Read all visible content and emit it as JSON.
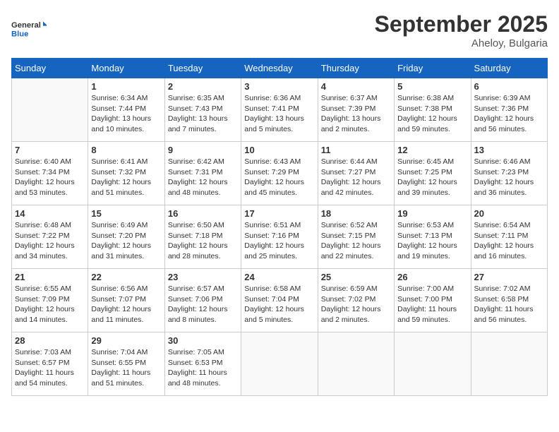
{
  "header": {
    "logo_general": "General",
    "logo_blue": "Blue",
    "month_title": "September 2025",
    "location": "Aheloy, Bulgaria"
  },
  "weekdays": [
    "Sunday",
    "Monday",
    "Tuesday",
    "Wednesday",
    "Thursday",
    "Friday",
    "Saturday"
  ],
  "weeks": [
    [
      {
        "day": "",
        "sunrise": "",
        "sunset": "",
        "daylight": ""
      },
      {
        "day": "1",
        "sunrise": "Sunrise: 6:34 AM",
        "sunset": "Sunset: 7:44 PM",
        "daylight": "Daylight: 13 hours and 10 minutes."
      },
      {
        "day": "2",
        "sunrise": "Sunrise: 6:35 AM",
        "sunset": "Sunset: 7:43 PM",
        "daylight": "Daylight: 13 hours and 7 minutes."
      },
      {
        "day": "3",
        "sunrise": "Sunrise: 6:36 AM",
        "sunset": "Sunset: 7:41 PM",
        "daylight": "Daylight: 13 hours and 5 minutes."
      },
      {
        "day": "4",
        "sunrise": "Sunrise: 6:37 AM",
        "sunset": "Sunset: 7:39 PM",
        "daylight": "Daylight: 13 hours and 2 minutes."
      },
      {
        "day": "5",
        "sunrise": "Sunrise: 6:38 AM",
        "sunset": "Sunset: 7:38 PM",
        "daylight": "Daylight: 12 hours and 59 minutes."
      },
      {
        "day": "6",
        "sunrise": "Sunrise: 6:39 AM",
        "sunset": "Sunset: 7:36 PM",
        "daylight": "Daylight: 12 hours and 56 minutes."
      }
    ],
    [
      {
        "day": "7",
        "sunrise": "Sunrise: 6:40 AM",
        "sunset": "Sunset: 7:34 PM",
        "daylight": "Daylight: 12 hours and 53 minutes."
      },
      {
        "day": "8",
        "sunrise": "Sunrise: 6:41 AM",
        "sunset": "Sunset: 7:32 PM",
        "daylight": "Daylight: 12 hours and 51 minutes."
      },
      {
        "day": "9",
        "sunrise": "Sunrise: 6:42 AM",
        "sunset": "Sunset: 7:31 PM",
        "daylight": "Daylight: 12 hours and 48 minutes."
      },
      {
        "day": "10",
        "sunrise": "Sunrise: 6:43 AM",
        "sunset": "Sunset: 7:29 PM",
        "daylight": "Daylight: 12 hours and 45 minutes."
      },
      {
        "day": "11",
        "sunrise": "Sunrise: 6:44 AM",
        "sunset": "Sunset: 7:27 PM",
        "daylight": "Daylight: 12 hours and 42 minutes."
      },
      {
        "day": "12",
        "sunrise": "Sunrise: 6:45 AM",
        "sunset": "Sunset: 7:25 PM",
        "daylight": "Daylight: 12 hours and 39 minutes."
      },
      {
        "day": "13",
        "sunrise": "Sunrise: 6:46 AM",
        "sunset": "Sunset: 7:23 PM",
        "daylight": "Daylight: 12 hours and 36 minutes."
      }
    ],
    [
      {
        "day": "14",
        "sunrise": "Sunrise: 6:48 AM",
        "sunset": "Sunset: 7:22 PM",
        "daylight": "Daylight: 12 hours and 34 minutes."
      },
      {
        "day": "15",
        "sunrise": "Sunrise: 6:49 AM",
        "sunset": "Sunset: 7:20 PM",
        "daylight": "Daylight: 12 hours and 31 minutes."
      },
      {
        "day": "16",
        "sunrise": "Sunrise: 6:50 AM",
        "sunset": "Sunset: 7:18 PM",
        "daylight": "Daylight: 12 hours and 28 minutes."
      },
      {
        "day": "17",
        "sunrise": "Sunrise: 6:51 AM",
        "sunset": "Sunset: 7:16 PM",
        "daylight": "Daylight: 12 hours and 25 minutes."
      },
      {
        "day": "18",
        "sunrise": "Sunrise: 6:52 AM",
        "sunset": "Sunset: 7:15 PM",
        "daylight": "Daylight: 12 hours and 22 minutes."
      },
      {
        "day": "19",
        "sunrise": "Sunrise: 6:53 AM",
        "sunset": "Sunset: 7:13 PM",
        "daylight": "Daylight: 12 hours and 19 minutes."
      },
      {
        "day": "20",
        "sunrise": "Sunrise: 6:54 AM",
        "sunset": "Sunset: 7:11 PM",
        "daylight": "Daylight: 12 hours and 16 minutes."
      }
    ],
    [
      {
        "day": "21",
        "sunrise": "Sunrise: 6:55 AM",
        "sunset": "Sunset: 7:09 PM",
        "daylight": "Daylight: 12 hours and 14 minutes."
      },
      {
        "day": "22",
        "sunrise": "Sunrise: 6:56 AM",
        "sunset": "Sunset: 7:07 PM",
        "daylight": "Daylight: 12 hours and 11 minutes."
      },
      {
        "day": "23",
        "sunrise": "Sunrise: 6:57 AM",
        "sunset": "Sunset: 7:06 PM",
        "daylight": "Daylight: 12 hours and 8 minutes."
      },
      {
        "day": "24",
        "sunrise": "Sunrise: 6:58 AM",
        "sunset": "Sunset: 7:04 PM",
        "daylight": "Daylight: 12 hours and 5 minutes."
      },
      {
        "day": "25",
        "sunrise": "Sunrise: 6:59 AM",
        "sunset": "Sunset: 7:02 PM",
        "daylight": "Daylight: 12 hours and 2 minutes."
      },
      {
        "day": "26",
        "sunrise": "Sunrise: 7:00 AM",
        "sunset": "Sunset: 7:00 PM",
        "daylight": "Daylight: 11 hours and 59 minutes."
      },
      {
        "day": "27",
        "sunrise": "Sunrise: 7:02 AM",
        "sunset": "Sunset: 6:58 PM",
        "daylight": "Daylight: 11 hours and 56 minutes."
      }
    ],
    [
      {
        "day": "28",
        "sunrise": "Sunrise: 7:03 AM",
        "sunset": "Sunset: 6:57 PM",
        "daylight": "Daylight: 11 hours and 54 minutes."
      },
      {
        "day": "29",
        "sunrise": "Sunrise: 7:04 AM",
        "sunset": "Sunset: 6:55 PM",
        "daylight": "Daylight: 11 hours and 51 minutes."
      },
      {
        "day": "30",
        "sunrise": "Sunrise: 7:05 AM",
        "sunset": "Sunset: 6:53 PM",
        "daylight": "Daylight: 11 hours and 48 minutes."
      },
      {
        "day": "",
        "sunrise": "",
        "sunset": "",
        "daylight": ""
      },
      {
        "day": "",
        "sunrise": "",
        "sunset": "",
        "daylight": ""
      },
      {
        "day": "",
        "sunrise": "",
        "sunset": "",
        "daylight": ""
      },
      {
        "day": "",
        "sunrise": "",
        "sunset": "",
        "daylight": ""
      }
    ]
  ]
}
